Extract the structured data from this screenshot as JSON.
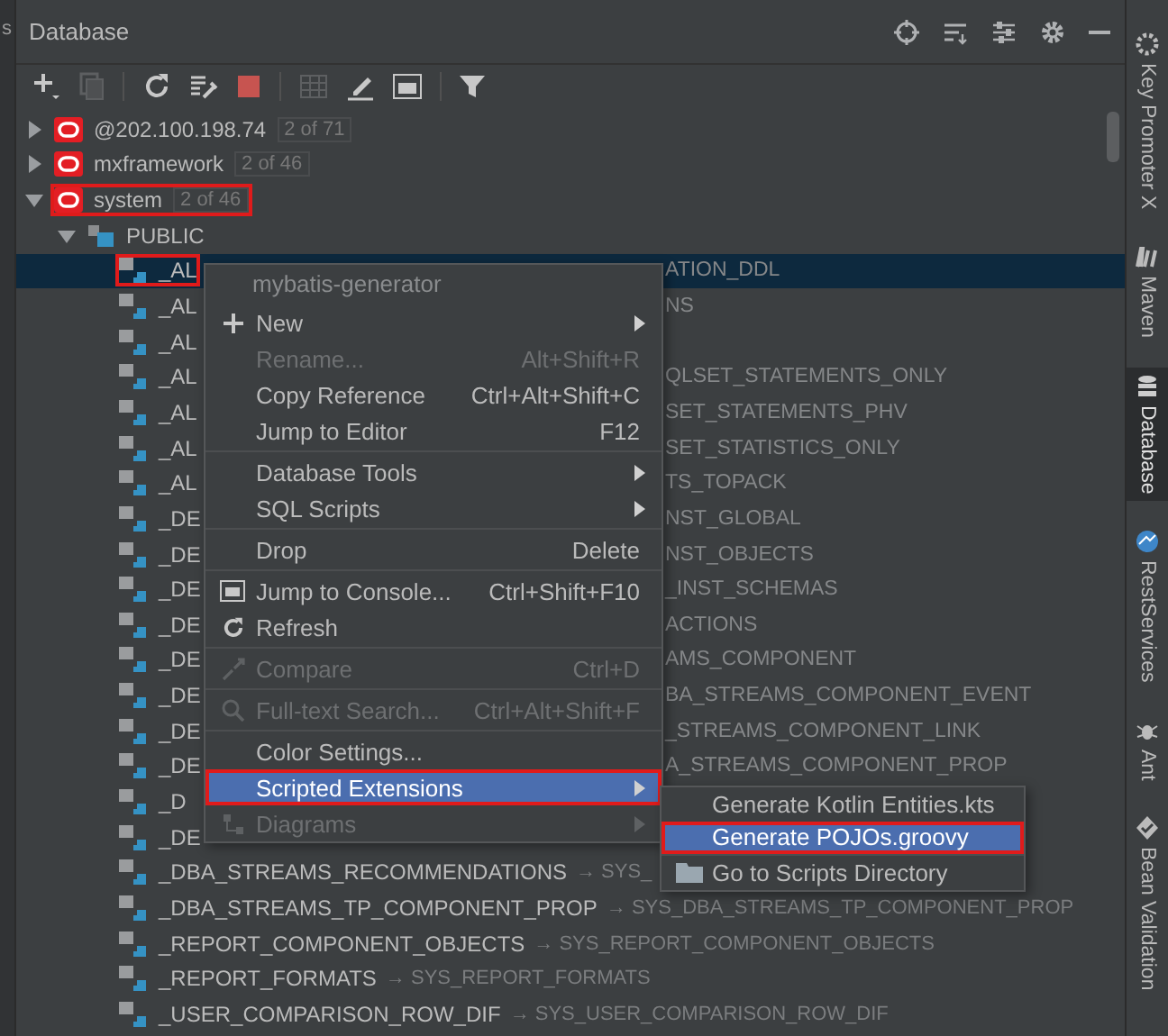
{
  "panel": {
    "left_stub": "s",
    "title": "Database"
  },
  "tree": [
    {
      "name": "@202.100.198.74",
      "count": "2 of 71",
      "expanded": false,
      "highlighted": false
    },
    {
      "name": "mxframework",
      "count": "2 of 46",
      "expanded": false,
      "highlighted": false
    },
    {
      "name": "system",
      "count": "2 of 46",
      "expanded": true,
      "highlighted": true,
      "children": [
        {
          "name": "PUBLIC",
          "expanded": true,
          "children": [
            {
              "name": "_AL",
              "tail": "ATION_DDL",
              "selected": true,
              "highlighted": true
            },
            {
              "name": "_AL",
              "tail": "NS",
              "selected": false,
              "highlighted": false
            },
            {
              "name": "_AL",
              "selected": false,
              "highlighted": false
            },
            {
              "name": "_AL",
              "tail": "QLSET_STATEMENTS_ONLY",
              "selected": false,
              "highlighted": false
            },
            {
              "name": "_AL",
              "tail": "SET_STATEMENTS_PHV",
              "selected": false,
              "highlighted": false
            },
            {
              "name": "_AL",
              "tail": "SET_STATISTICS_ONLY",
              "selected": false,
              "highlighted": false
            },
            {
              "name": "_AL",
              "tail": "TS_TOPACK",
              "selected": false,
              "highlighted": false
            },
            {
              "name": "_DE",
              "tail": "NST_GLOBAL",
              "selected": false,
              "highlighted": false
            },
            {
              "name": "_DE",
              "tail": "NST_OBJECTS",
              "selected": false,
              "highlighted": false
            },
            {
              "name": "_DE",
              "tail": "_INST_SCHEMAS",
              "selected": false,
              "highlighted": false
            },
            {
              "name": "_DE",
              "tail": "ACTIONS",
              "selected": false,
              "highlighted": false
            },
            {
              "name": "_DE",
              "tail": "AMS_COMPONENT",
              "selected": false,
              "highlighted": false
            },
            {
              "name": "_DE",
              "tail": "BA_STREAMS_COMPONENT_EVENT",
              "selected": false,
              "highlighted": false
            },
            {
              "name": "_DE",
              "tail": "_STREAMS_COMPONENT_LINK",
              "selected": false,
              "highlighted": false
            },
            {
              "name": "_DE",
              "tail": "A_STREAMS_COMPONENT_PROP",
              "selected": false,
              "highlighted": false
            },
            {
              "name": "_D",
              "selected": false,
              "highlighted": false
            },
            {
              "name": "_DE",
              "selected": false,
              "highlighted": false
            },
            {
              "name": "_DBA_STREAMS_RECOMMENDATIONS",
              "target": "→ SYS_",
              "selected": false,
              "highlighted": false
            },
            {
              "name": "_DBA_STREAMS_TP_COMPONENT_PROP",
              "target": "→ SYS_DBA_STREAMS_TP_COMPONENT_PROP",
              "selected": false,
              "highlighted": false
            },
            {
              "name": "_REPORT_COMPONENT_OBJECTS",
              "target": "→ SYS_REPORT_COMPONENT_OBJECTS",
              "selected": false,
              "highlighted": false
            },
            {
              "name": "_REPORT_FORMATS",
              "target": "→ SYS_REPORT_FORMATS",
              "selected": false,
              "highlighted": false
            },
            {
              "name": "_USER_COMPARISON_ROW_DIF",
              "target": "→ SYS_USER_COMPARISON_ROW_DIF",
              "selected": false,
              "highlighted": false
            }
          ]
        }
      ]
    }
  ],
  "context_menu": {
    "header": "mybatis-generator",
    "items": [
      {
        "kind": "item",
        "label": "New",
        "submenu": true,
        "disabled": false,
        "selected": false,
        "highlighted": false
      },
      {
        "kind": "item",
        "label": "Rename...",
        "shortcut": "Alt+Shift+R",
        "submenu": false,
        "disabled": true,
        "selected": false,
        "highlighted": false
      },
      {
        "kind": "item",
        "label": "Copy Reference",
        "shortcut": "Ctrl+Alt+Shift+C",
        "submenu": false,
        "disabled": false,
        "selected": false,
        "highlighted": false
      },
      {
        "kind": "item",
        "label": "Jump to Editor",
        "shortcut": "F12",
        "submenu": false,
        "disabled": false,
        "selected": false,
        "highlighted": false
      },
      {
        "kind": "separator"
      },
      {
        "kind": "item",
        "label": "Database Tools",
        "submenu": true,
        "disabled": false,
        "selected": false,
        "highlighted": false
      },
      {
        "kind": "item",
        "label": "SQL Scripts",
        "submenu": true,
        "disabled": false,
        "selected": false,
        "highlighted": false
      },
      {
        "kind": "separator"
      },
      {
        "kind": "item",
        "label": "Drop",
        "shortcut": "Delete",
        "submenu": false,
        "disabled": false,
        "selected": false,
        "highlighted": false
      },
      {
        "kind": "separator"
      },
      {
        "kind": "item",
        "label": "Jump to Console...",
        "shortcut": "Ctrl+Shift+F10",
        "submenu": false,
        "disabled": false,
        "selected": false,
        "highlighted": false
      },
      {
        "kind": "item",
        "label": "Refresh",
        "submenu": false,
        "disabled": false,
        "selected": false,
        "highlighted": false
      },
      {
        "kind": "separator"
      },
      {
        "kind": "item",
        "label": "Compare",
        "shortcut": "Ctrl+D",
        "submenu": false,
        "disabled": true,
        "selected": false,
        "highlighted": false
      },
      {
        "kind": "separator"
      },
      {
        "kind": "item",
        "label": "Full-text Search...",
        "shortcut": "Ctrl+Alt+Shift+F",
        "submenu": false,
        "disabled": true,
        "selected": false,
        "highlighted": false
      },
      {
        "kind": "separator"
      },
      {
        "kind": "item",
        "label": "Color Settings...",
        "submenu": false,
        "disabled": false,
        "selected": false,
        "highlighted": false
      },
      {
        "kind": "item",
        "label": "Scripted Extensions",
        "submenu": true,
        "disabled": false,
        "selected": true,
        "highlighted": true
      },
      {
        "kind": "item",
        "label": "Diagrams",
        "submenu": true,
        "disabled": true,
        "selected": false,
        "highlighted": false
      }
    ]
  },
  "submenu": {
    "items": [
      {
        "kind": "item",
        "label": "Generate Kotlin Entities.kts",
        "selected": false,
        "highlighted": false
      },
      {
        "kind": "item",
        "label": "Generate POJOs.groovy",
        "selected": true,
        "highlighted": true
      },
      {
        "kind": "separator"
      },
      {
        "kind": "item",
        "label": "Go to Scripts Directory",
        "selected": false,
        "highlighted": false
      }
    ]
  },
  "tool_windows": [
    {
      "label": "Key Promoter X",
      "selected": false
    },
    {
      "label": "Maven",
      "selected": false
    },
    {
      "label": "Database",
      "selected": true
    },
    {
      "label": "RestServices",
      "selected": false
    },
    {
      "label": "Ant",
      "selected": false
    },
    {
      "label": "Bean Validation",
      "selected": false
    }
  ]
}
